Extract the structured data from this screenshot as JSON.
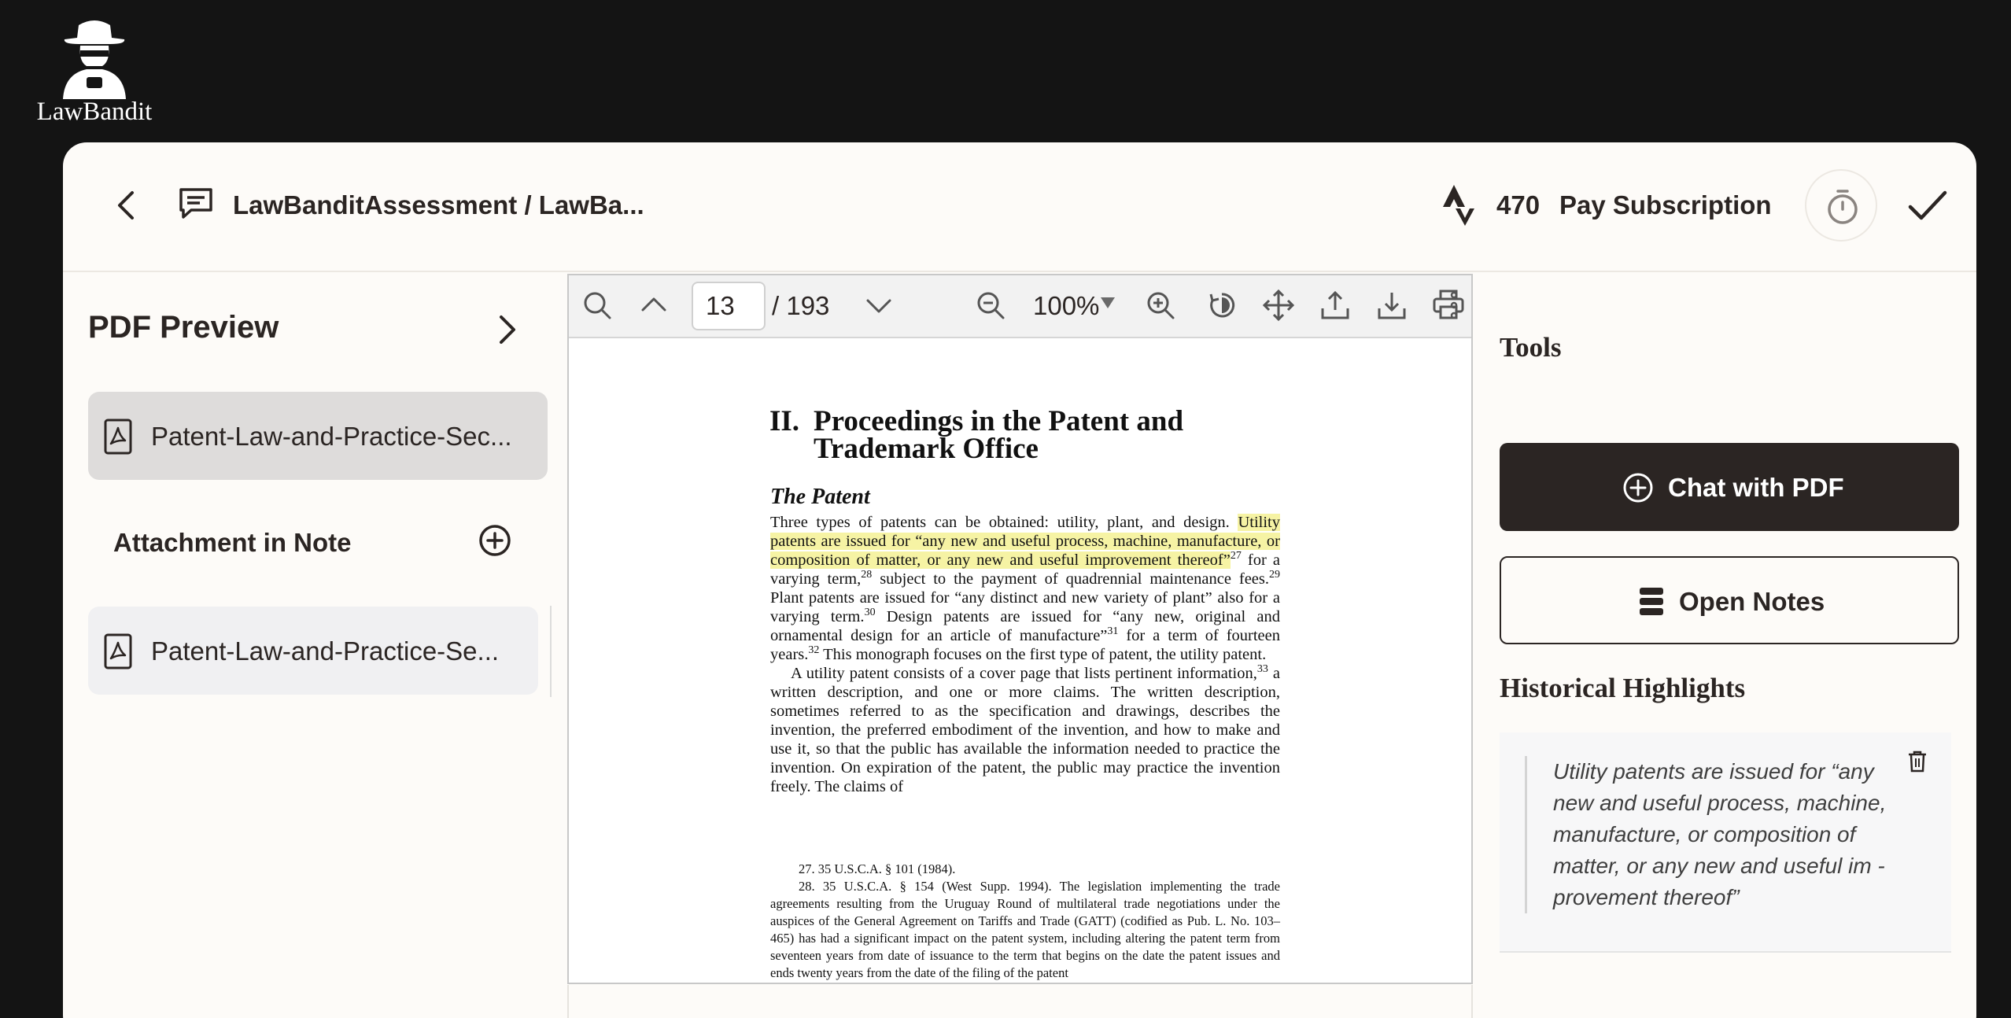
{
  "brand": {
    "name": "LawBandit"
  },
  "header": {
    "document_path": "LawBanditAssessment / LawBa...",
    "credits": "470",
    "pay_label": "Pay Subscription"
  },
  "sidebar": {
    "title": "PDF Preview",
    "active_file": "Patent-Law-and-Practice-Sec...",
    "attachment_label": "Attachment in Note",
    "attachment_file": "Patent-Law-and-Practice-Se..."
  },
  "viewer": {
    "current_page": "13",
    "total_pages": "/ 193",
    "zoom": "100%"
  },
  "pdf": {
    "heading_num": "II.",
    "heading_text": "Proceedings in the Patent and Trademark Office",
    "subheading": "The Patent",
    "p1_a": "Three types of patents can be obtained: utility, plant, and design. ",
    "p1_highlight": "Utility patents are issued for “any new and useful process, machine, manufacture, or composition of matter, or any new and useful im­provement thereof”",
    "fn27": "27",
    "p1_b": " for a varying term,",
    "fn28": "28",
    "p1_c": " subject to the payment of quadrennial maintenance fees.",
    "fn29": "29",
    "p1_d": " Plant patents are issued for “any distinct and new variety of plant” also for a varying term.",
    "fn30": "30",
    "p1_e": " Design patents are issued for “any new, original and ornamental design for an article of manufacture”",
    "fn31": "31",
    "p1_f": " for a term of fourteen years.",
    "fn32": "32",
    "p1_g": " This monograph focuses on the first type of patent, the utility patent.",
    "p2_a": "A utility patent consists of a cover page that lists pertinent infor­mation,",
    "fn33": "33",
    "p2_b": " a written description, and one or more claims. The written description, sometimes referred to as the specification and drawings, describes the invention, the preferred embodiment of the invention, and how to make and use it, so that the public has available the information needed to practice the invention. On expiration of the patent, the public may practice the invention freely. The claims of",
    "footnote_27": "27. 35 U.S.C.A. § 101 (1984).",
    "footnote_28": "28. 35 U.S.C.A. § 154 (West Supp. 1994). The legislation implementing the trade agreements resulting from the Uruguay Round of multilateral trade negotiations under the auspices of the General Agreement on Tariffs and Trade (GATT) (codified as Pub. L. No. 103–465) has had a significant impact on the patent system, including altering the patent term from seventeen years from date of issuance to the term that begins on the date the patent issues and ends twenty years from the date of the filing of the patent"
  },
  "right_panel": {
    "tools_title": "Tools",
    "chat_label": "Chat with PDF",
    "notes_label": "Open Notes",
    "history_title": "Historical Highlights",
    "highlight_text": "Utility patents are issued for “any new and useful process, machine, manufacture, or composition of matter, or any new and useful im - provement thereof”"
  },
  "colors": {
    "dark": "#2b2523",
    "background": "#141414",
    "card": "#fdfbf8",
    "highlight": "#f6f3a4"
  },
  "icons": [
    "back-chevron-icon",
    "chat-icon",
    "strava-icon",
    "timer-icon",
    "check-icon",
    "chevron-right-icon",
    "pdf-file-icon",
    "plus-circle-icon",
    "search-icon",
    "chevron-up-icon",
    "chevron-down-icon",
    "zoom-out-icon",
    "zoom-in-icon",
    "rotate-icon",
    "move-icon",
    "upload-icon",
    "download-icon",
    "print-icon",
    "more-vertical-icon",
    "trash-icon",
    "notes-icon"
  ]
}
